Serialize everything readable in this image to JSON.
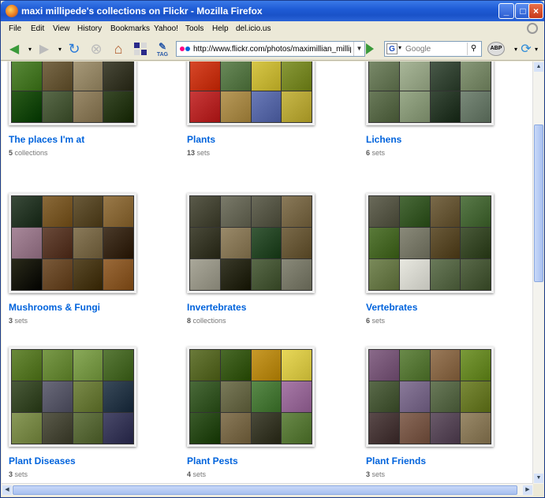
{
  "window": {
    "title": "maxi millipede's collections on Flickr - Mozilla Firefox"
  },
  "menu": [
    "File",
    "Edit",
    "View",
    "History",
    "Bookmarks",
    "Yahoo!",
    "Tools",
    "Help",
    "del.icio.us"
  ],
  "nav": {
    "url": "http://www.flickr.com/photos/maximillian_millipede",
    "search_placeholder": "Google",
    "tag_label": "TAG",
    "abp_label": "ABP"
  },
  "collections": [
    {
      "name": "The places I'm at",
      "count": "5",
      "unit": " collections",
      "colors": [
        "#4a6a2c",
        "#6b7a3a",
        "#8a7a6a",
        "#3a5a2a",
        "#5a8a3a",
        "#7a6a4a",
        "#a89a7a",
        "#4a4a3a",
        "#2a5a1a",
        "#5a6a4a",
        "#9a8a6a",
        "#3a4a2a"
      ]
    },
    {
      "name": "Plants",
      "count": "13",
      "unit": " sets",
      "colors": [
        "#c83a6a",
        "#8a6a8a",
        "#c8a83a",
        "#a89a2a",
        "#d8482a",
        "#6a8a5a",
        "#d8c84a",
        "#8a9a3a",
        "#c83a3a",
        "#b89a5a",
        "#6a7ab8",
        "#c8b84a"
      ]
    },
    {
      "name": "Lichens",
      "count": "6",
      "unit": " sets",
      "colors": [
        "#8a9a8a",
        "#6a7a6a",
        "#9aa88a",
        "#5a6a5a",
        "#7a8a6a",
        "#aab89a",
        "#4a5a4a",
        "#8a9a7a",
        "#6a7a5a",
        "#9aaa8a",
        "#3a4a3a",
        "#7a8a7a"
      ]
    },
    {
      "name": "Mushrooms & Fungi",
      "count": "3",
      "unit": " sets",
      "colors": [
        "#3a4a3a",
        "#8a6a3a",
        "#6a5a3a",
        "#9a7a4a",
        "#a8889a",
        "#6a4a3a",
        "#8a7a5a",
        "#4a3a2a",
        "#2a2a1a",
        "#7a5a3a",
        "#5a4a2a",
        "#9a6a3a"
      ]
    },
    {
      "name": "Invertebrates",
      "count": "8",
      "unit": " collections",
      "colors": [
        "#5a5a4a",
        "#7a7a6a",
        "#6a6a5a",
        "#8a7a5a",
        "#4a4a3a",
        "#9a8a6a",
        "#3a5a3a",
        "#7a6a4a",
        "#aaa89a",
        "#3a3a2a",
        "#5a6a4a",
        "#8a8a7a"
      ]
    },
    {
      "name": "Vertebrates",
      "count": "6",
      "unit": " sets",
      "colors": [
        "#6a6a5a",
        "#4a6a3a",
        "#7a6a4a",
        "#5a7a4a",
        "#5a7a3a",
        "#8a8a7a",
        "#6a5a3a",
        "#4a5a3a",
        "#7a8a5a",
        "#e8e8e0",
        "#6a7a5a",
        "#5a6a4a"
      ]
    },
    {
      "name": "Plant Diseases",
      "count": "3",
      "unit": " sets",
      "colors": [
        "#6a8a3a",
        "#7a9a4a",
        "#8aaa5a",
        "#5a7a3a",
        "#4a5a3a",
        "#6a6a7a",
        "#7a8a4a",
        "#3a4a5a",
        "#8a9a5a",
        "#5a5a4a",
        "#6a7a4a",
        "#4a4a6a"
      ]
    },
    {
      "name": "Plant Pests",
      "count": "4",
      "unit": " sets",
      "colors": [
        "#6a7a3a",
        "#4a6a2a",
        "#c89a2a",
        "#e8d85a",
        "#4a6a3a",
        "#7a7a5a",
        "#5a8a4a",
        "#a87aa8",
        "#3a5a2a",
        "#8a7a5a",
        "#4a4a3a",
        "#6a8a4a"
      ]
    },
    {
      "name": "Plant Friends",
      "count": "3",
      "unit": " sets",
      "colors": [
        "#8a6a8a",
        "#6a8a4a",
        "#9a7a5a",
        "#7a9a3a",
        "#5a6a4a",
        "#8a7a9a",
        "#6a7a5a",
        "#7a8a3a",
        "#5a4a4a",
        "#8a6a5a",
        "#6a5a6a",
        "#9a8a6a"
      ]
    }
  ]
}
